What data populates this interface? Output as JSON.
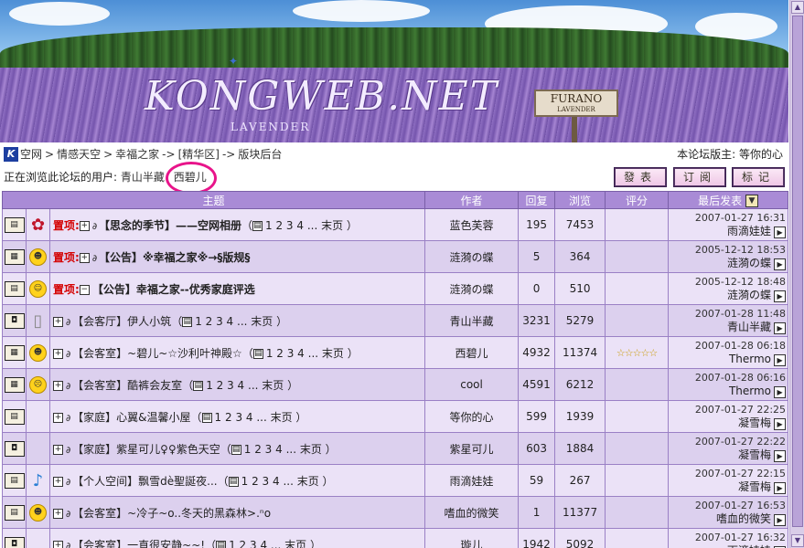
{
  "banner": {
    "logo_text": "KONGWEB.NET",
    "logo_subtitle": "LAVENDER",
    "sign_title": "FURANO",
    "sign_subtitle": "LAVENDER"
  },
  "breadcrumb": {
    "items": [
      "空网",
      "情感天空",
      "幸福之家",
      "[精华区]",
      "版块后台"
    ],
    "separators": [
      ">",
      ">",
      "->",
      "->"
    ]
  },
  "moderator_text": "本论坛版主: 等你的心",
  "browsing": {
    "label": "正在浏览此论坛的用户:",
    "users": [
      "青山半藏",
      "西碧儿"
    ]
  },
  "buttons": {
    "post": "發表",
    "subscribe": "订阅",
    "mark": "标记"
  },
  "table": {
    "headers": {
      "topic": "主题",
      "author": "作者",
      "replies": "回复",
      "views": "浏览",
      "rating": "评分",
      "last_post": "最后发表"
    },
    "rows": [
      {
        "pin": "置项:",
        "title": "【思念的季节】——空网相册",
        "pages": "1 2 3 4 ... 末页",
        "author": "蓝色芙蓉",
        "replies": "195",
        "views": "7453",
        "rating": "",
        "last_date": "2007-01-27 16:31",
        "last_by": "雨滴娃娃",
        "mood": "flower-icon",
        "folder": "book-icon"
      },
      {
        "pin": "置项:",
        "title": "【公告】※幸福之家※→§版规§",
        "pages": "",
        "author": "涟漪の蝶",
        "replies": "5",
        "views": "364",
        "rating": "",
        "last_date": "2005-12-12 18:53",
        "last_by": "涟漪の蝶",
        "mood": "cool-smiley-icon",
        "folder": "news-icon"
      },
      {
        "pin": "置项:",
        "title": "【公告】幸福之家--优秀家庭评选",
        "pages": "",
        "author": "涟漪の蝶",
        "replies": "0",
        "views": "510",
        "rating": "",
        "last_date": "2005-12-12 18:48",
        "last_by": "涟漪の蝶",
        "mood": "smiley-icon",
        "folder": "book-icon"
      },
      {
        "pin": "",
        "title": "【会客厅】伊人小筑",
        "pages": "1 2 3 4 ... 末页",
        "author": "青山半藏",
        "replies": "3231",
        "views": "5279",
        "rating": "",
        "last_date": "2007-01-28 11:48",
        "last_by": "青山半藏",
        "mood": "paper-icon",
        "folder": "camera-icon"
      },
      {
        "pin": "",
        "title": "【会客室】~碧儿~☆沙利叶神殿☆",
        "pages": "1 2 3 4 ... 末页",
        "author": "西碧儿",
        "replies": "4932",
        "views": "11374",
        "rating": "☆☆☆☆☆",
        "last_date": "2007-01-28 06:18",
        "last_by": "Thermo",
        "mood": "cool-smiley-icon",
        "folder": "news-icon"
      },
      {
        "pin": "",
        "title": "【会客室】酷裤会友室",
        "pages": "1 2 3 4 ... 末页",
        "author": "cool",
        "replies": "4591",
        "views": "6212",
        "rating": "",
        "last_date": "2007-01-28 06:16",
        "last_by": "Thermo",
        "mood": "angry-smiley-icon",
        "folder": "news-icon"
      },
      {
        "pin": "",
        "title": "【家庭】心翼&温馨小屋",
        "pages": "1 2 3 4 ... 末页",
        "author": "等你的心",
        "replies": "599",
        "views": "1939",
        "rating": "",
        "last_date": "2007-01-27 22:25",
        "last_by": "凝雪梅",
        "mood": "",
        "folder": "book-icon"
      },
      {
        "pin": "",
        "title": "【家庭】紫星可儿♀♀紫色天空",
        "pages": "1 2 3 4 ... 末页",
        "author": "紫星可儿",
        "replies": "603",
        "views": "1884",
        "rating": "",
        "last_date": "2007-01-27 22:22",
        "last_by": "凝雪梅",
        "mood": "",
        "folder": "camera-icon"
      },
      {
        "pin": "",
        "title": "【个人空间】飘雪dè聖誕夜...",
        "pages": "1 2 3 4 ... 末页",
        "author": "雨滴娃娃",
        "replies": "59",
        "views": "267",
        "rating": "",
        "last_date": "2007-01-27 22:15",
        "last_by": "凝雪梅",
        "mood": "music-note-icon",
        "folder": "book-icon"
      },
      {
        "pin": "",
        "title": "【会客室】~冷子~o..冬天的黑森林>.ⁿo",
        "pages": "",
        "author": "嗜血的微笑",
        "replies": "1",
        "views": "11377",
        "rating": "",
        "last_date": "2007-01-27 16:53",
        "last_by": "嗜血的微笑",
        "mood": "cool-smiley-icon",
        "folder": "book-icon"
      },
      {
        "pin": "",
        "title": "【会客室】一直很安静~~!",
        "pages": "1 2 3 4 ... 末页",
        "author": "璇儿",
        "replies": "1942",
        "views": "5092",
        "rating": "",
        "last_date": "2007-01-27 16:32",
        "last_by": "雨滴娃娃",
        "mood": "",
        "folder": "camera-icon"
      }
    ]
  }
}
